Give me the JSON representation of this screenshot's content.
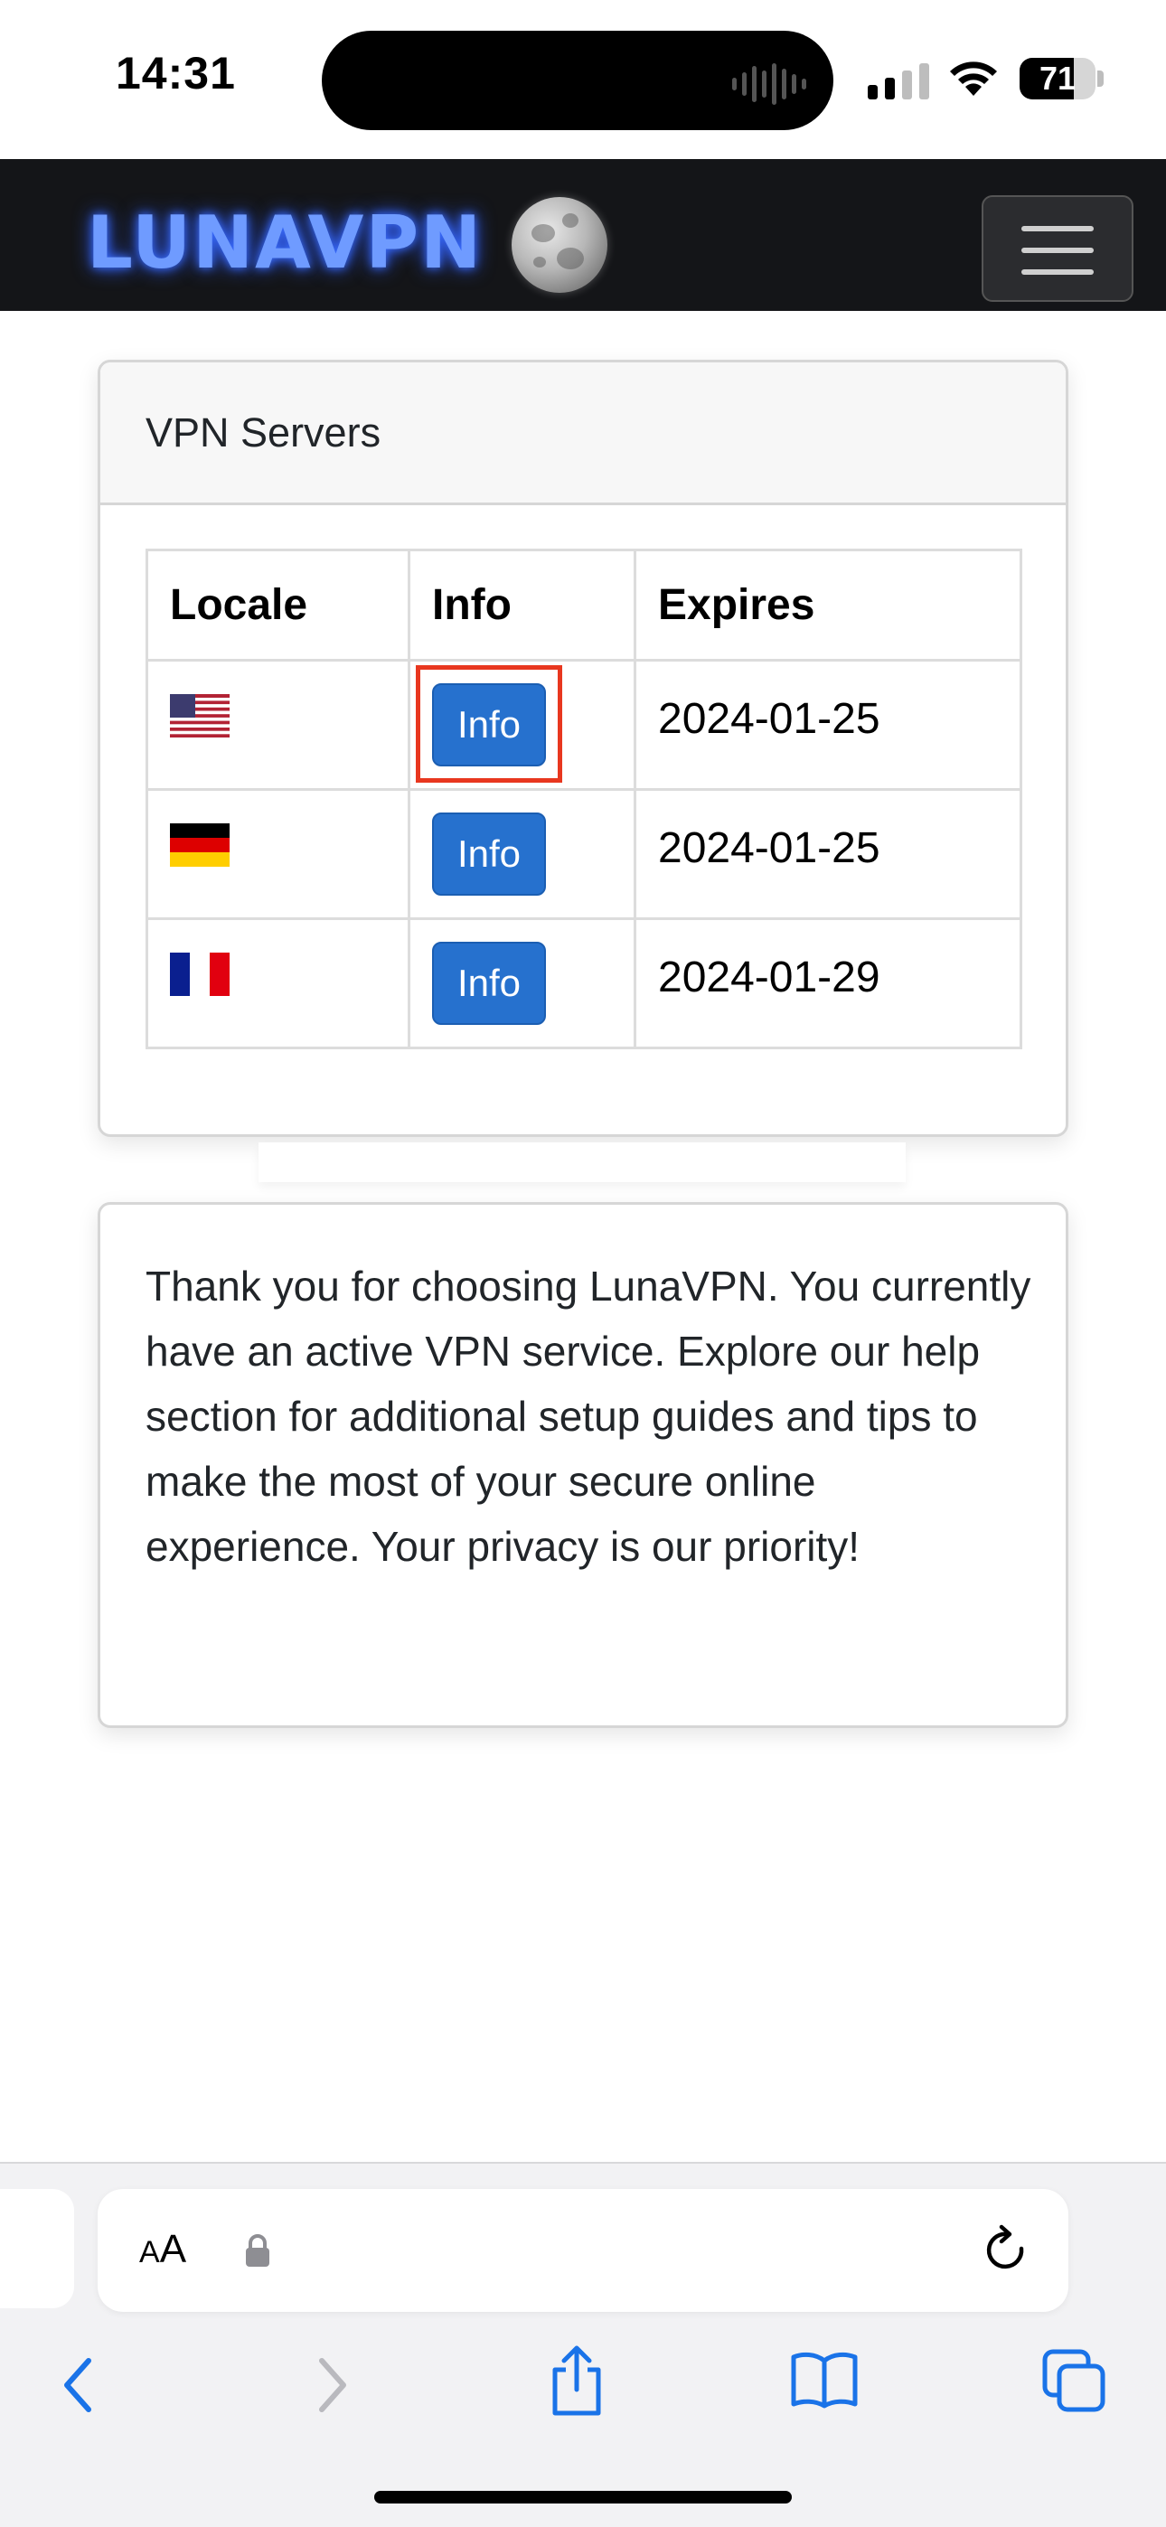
{
  "status_bar": {
    "time": "14:31",
    "battery_level": "71",
    "battery_fraction": 0.71
  },
  "navbar": {
    "brand": "LUNAVPN",
    "brand_color": "#6f9bff",
    "moon_icon": "moon-icon",
    "menu_icon": "hamburger-icon"
  },
  "servers_card": {
    "title": "VPN Servers",
    "columns": [
      "Locale",
      "Info",
      "Expires"
    ],
    "rows": [
      {
        "flag": "us-flag-icon",
        "info_label": "Info",
        "expires": "2024-01-25"
      },
      {
        "flag": "de-flag-icon",
        "info_label": "Info",
        "expires": "2024-01-25"
      },
      {
        "flag": "fr-flag-icon",
        "info_label": "Info",
        "expires": "2024-01-29"
      }
    ],
    "button_color": "#2671ce",
    "highlight_color": "#e8371f"
  },
  "message_card": {
    "text": "Thank you for choosing LunaVPN. You currently have an active VPN service. Explore our help section for additional setup guides and tips to make the most of your secure online experience. Your privacy is our priority!"
  },
  "safari": {
    "aa_small": "A",
    "aa_big": "A",
    "url": "",
    "toolbar": [
      "back-icon",
      "forward-icon",
      "share-icon",
      "bookmarks-icon",
      "tabs-icon"
    ]
  }
}
